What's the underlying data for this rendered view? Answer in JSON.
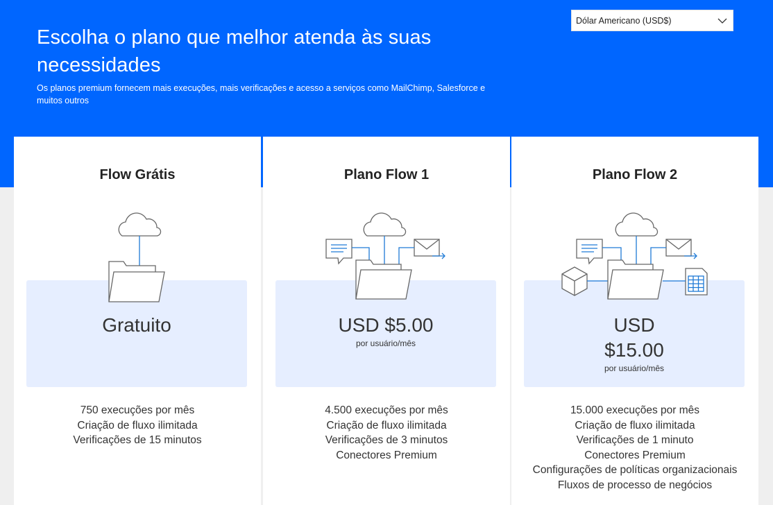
{
  "header": {
    "title": "Escolha o plano que melhor atenda às suas necessidades",
    "subtitle": "Os planos premium fornecem mais execuções, mais verificações e acesso a serviços como MailChimp, Salesforce e muitos outros"
  },
  "currency_select": {
    "selected": "Dólar Americano (USD$)"
  },
  "colors": {
    "hero": "#0066ff",
    "accent": "#0078d4",
    "price_box": "#e6eeff"
  },
  "plans": [
    {
      "title": "Flow Grátis",
      "price": "Gratuito",
      "features": [
        "750 execuções por mês",
        "Criação de fluxo ilimitada",
        "Verificações de 15 minutos"
      ]
    },
    {
      "title": "Plano Flow 1",
      "price": "USD $5.00",
      "unit": "por usuário/mês",
      "features": [
        "4.500 execuções por mês",
        "Criação de fluxo ilimitada",
        "Verificações de 3 minutos",
        "Conectores Premium"
      ]
    },
    {
      "title": "Plano Flow 2",
      "price_line1": "USD",
      "price_line2": "$15.00",
      "unit": "por usuário/mês",
      "features": [
        "15.000 execuções por mês",
        "Criação de fluxo ilimitada",
        "Verificações de 1 minuto",
        "Conectores Premium",
        "Configurações de políticas organizacionais",
        "Fluxos de processo de negócios"
      ]
    }
  ]
}
